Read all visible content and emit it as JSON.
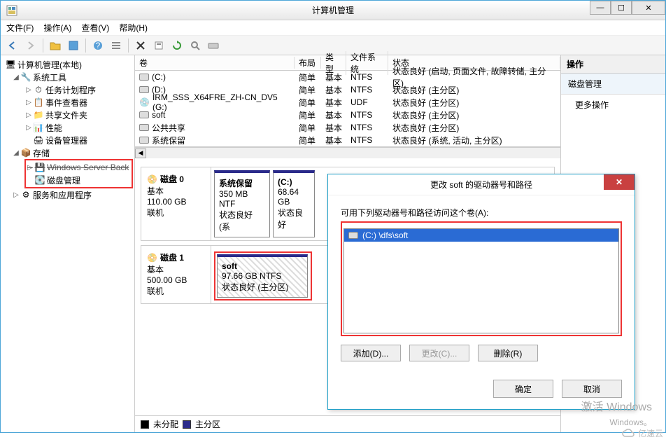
{
  "window": {
    "title": "计算机管理"
  },
  "winbtns": {
    "min": "—",
    "max": "☐",
    "close": "✕"
  },
  "menu": {
    "file": "文件(F)",
    "action": "操作(A)",
    "view": "查看(V)",
    "help": "帮助(H)"
  },
  "tree": {
    "root": "计算机管理(本地)",
    "systools": "系统工具",
    "taskscheduler": "任务计划程序",
    "eventviewer": "事件查看器",
    "sharedfolders": "共享文件夹",
    "performance": "性能",
    "devicemgr": "设备管理器",
    "storage": "存储",
    "wsb": "Windows Server Back",
    "diskmgmt": "磁盘管理",
    "services": "服务和应用程序"
  },
  "volheader": {
    "vol": "卷",
    "layout": "布局",
    "type": "类型",
    "fs": "文件系统",
    "status": "状态"
  },
  "volumes": [
    {
      "name": "(C:)",
      "layout": "简单",
      "type": "基本",
      "fs": "NTFS",
      "status": "状态良好 (启动, 页面文件, 故障转储, 主分区)"
    },
    {
      "name": "(D:)",
      "layout": "简单",
      "type": "基本",
      "fs": "NTFS",
      "status": "状态良好 (主分区)"
    },
    {
      "name": "IRM_SSS_X64FRE_ZH-CN_DV5 (G:)",
      "layout": "简单",
      "type": "基本",
      "fs": "UDF",
      "status": "状态良好 (主分区)"
    },
    {
      "name": "soft",
      "layout": "简单",
      "type": "基本",
      "fs": "NTFS",
      "status": "状态良好 (主分区)"
    },
    {
      "name": "公共共享",
      "layout": "简单",
      "type": "基本",
      "fs": "NTFS",
      "status": "状态良好 (主分区)"
    },
    {
      "name": "系统保留",
      "layout": "简单",
      "type": "基本",
      "fs": "NTFS",
      "status": "状态良好 (系统, 活动, 主分区)"
    }
  ],
  "disks": {
    "d0": {
      "label": "磁盘 0",
      "type": "基本",
      "size": "110.00 GB",
      "state": "联机",
      "parts": [
        {
          "name": "系统保留",
          "size": "350 MB NTF",
          "status": "状态良好 (系"
        },
        {
          "name": "(C:)",
          "size": "68.64 GB",
          "status": "状态良好"
        }
      ]
    },
    "d1": {
      "label": "磁盘 1",
      "type": "基本",
      "size": "500.00 GB",
      "state": "联机",
      "parts": [
        {
          "name": "soft",
          "size": "97.66 GB NTFS",
          "status": "状态良好 (主分区)"
        }
      ]
    }
  },
  "legend": {
    "unalloc": "未分配",
    "primary": "主分区"
  },
  "actions": {
    "header": "操作",
    "section": "磁盘管理",
    "more": "更多操作"
  },
  "dialog": {
    "title": "更改 soft 的驱动器号和路径",
    "prompt": "可用下列驱动器号和路径访问这个卷(A):",
    "entry": "(C:) \\dfs\\soft",
    "add": "添加(D)...",
    "change": "更改(C)...",
    "remove": "删除(R)",
    "ok": "确定",
    "cancel": "取消"
  },
  "watermark": {
    "l1": "激活 Windows",
    "l2": "Windows。"
  },
  "brand": "亿速云"
}
